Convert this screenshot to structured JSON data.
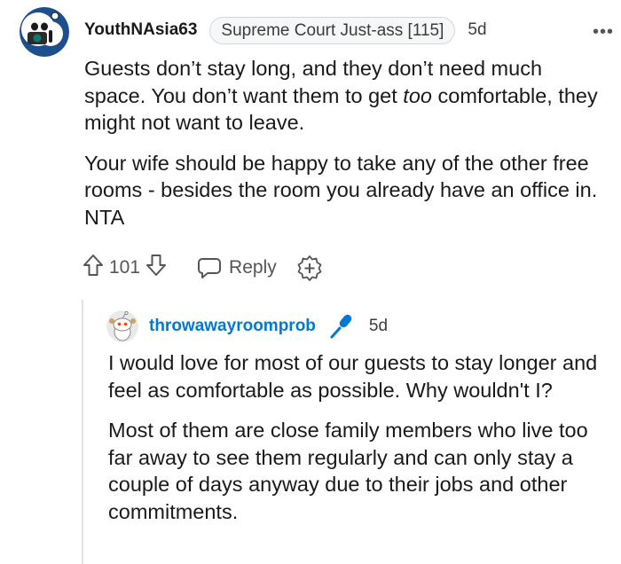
{
  "comment": {
    "username": "YouthNAsia63",
    "flair": "Supreme Court Just-ass [115]",
    "age": "5d",
    "more_label": "•••",
    "paragraphs": [
      "Guests don’t stay long, and they don’t need much space. You don’t want them to get too comfortable, they might not want to leave.",
      "Your wife should be happy to take any of the other free rooms - besides the room you already have an office in. NTA"
    ],
    "emphasis_word": "too",
    "score": "101",
    "reply_label": "Reply"
  },
  "reply": {
    "username": "throwawayroomprob",
    "age": "5d",
    "more_label": "•••",
    "paragraphs": [
      "I would love for most of our guests to stay longer and feel as comfortable as possible. Why wouldn't I?",
      "Most of them are close family members who live too far away to see them regularly and can only stay a couple of days anyway due to their jobs and other commitments."
    ]
  },
  "colors": {
    "op_username": "#0079d3",
    "text": "#1a1a1b",
    "muted": "#555555"
  },
  "icons": [
    "snoo-avatar-icon",
    "more-options-icon",
    "upvote-icon",
    "downvote-icon",
    "reply-icon",
    "award-icon",
    "microphone-icon"
  ]
}
